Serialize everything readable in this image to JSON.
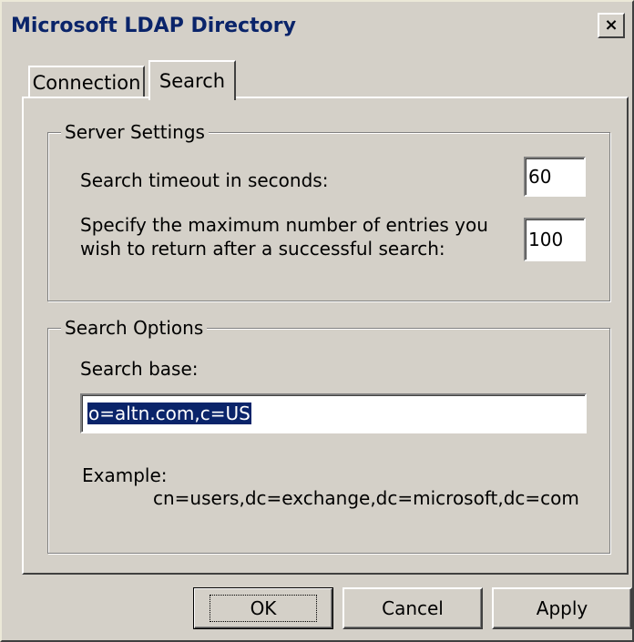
{
  "window": {
    "title": "Microsoft LDAP Directory",
    "close_label": "×"
  },
  "tabs": [
    {
      "label": "Connection",
      "selected": false
    },
    {
      "label": "Search",
      "selected": true
    }
  ],
  "server_settings": {
    "legend": "Server Settings",
    "timeout_label": "Search timeout in seconds:",
    "timeout_value": "60",
    "max_entries_label_line1": "Specify the maximum number of entries you",
    "max_entries_label_line2": "wish to return after a successful search:",
    "max_entries_value": "100"
  },
  "search_options": {
    "legend": "Search Options",
    "search_base_label": "Search base:",
    "search_base_value": "o=altn.com,c=US",
    "example_label": "Example:",
    "example_value": "cn=users,dc=exchange,dc=microsoft,dc=com"
  },
  "buttons": {
    "ok": "OK",
    "cancel": "Cancel",
    "apply": "Apply"
  },
  "colors": {
    "face": "#d4d0c8",
    "title_text": "#0a246a",
    "selection": "#0a246a"
  }
}
